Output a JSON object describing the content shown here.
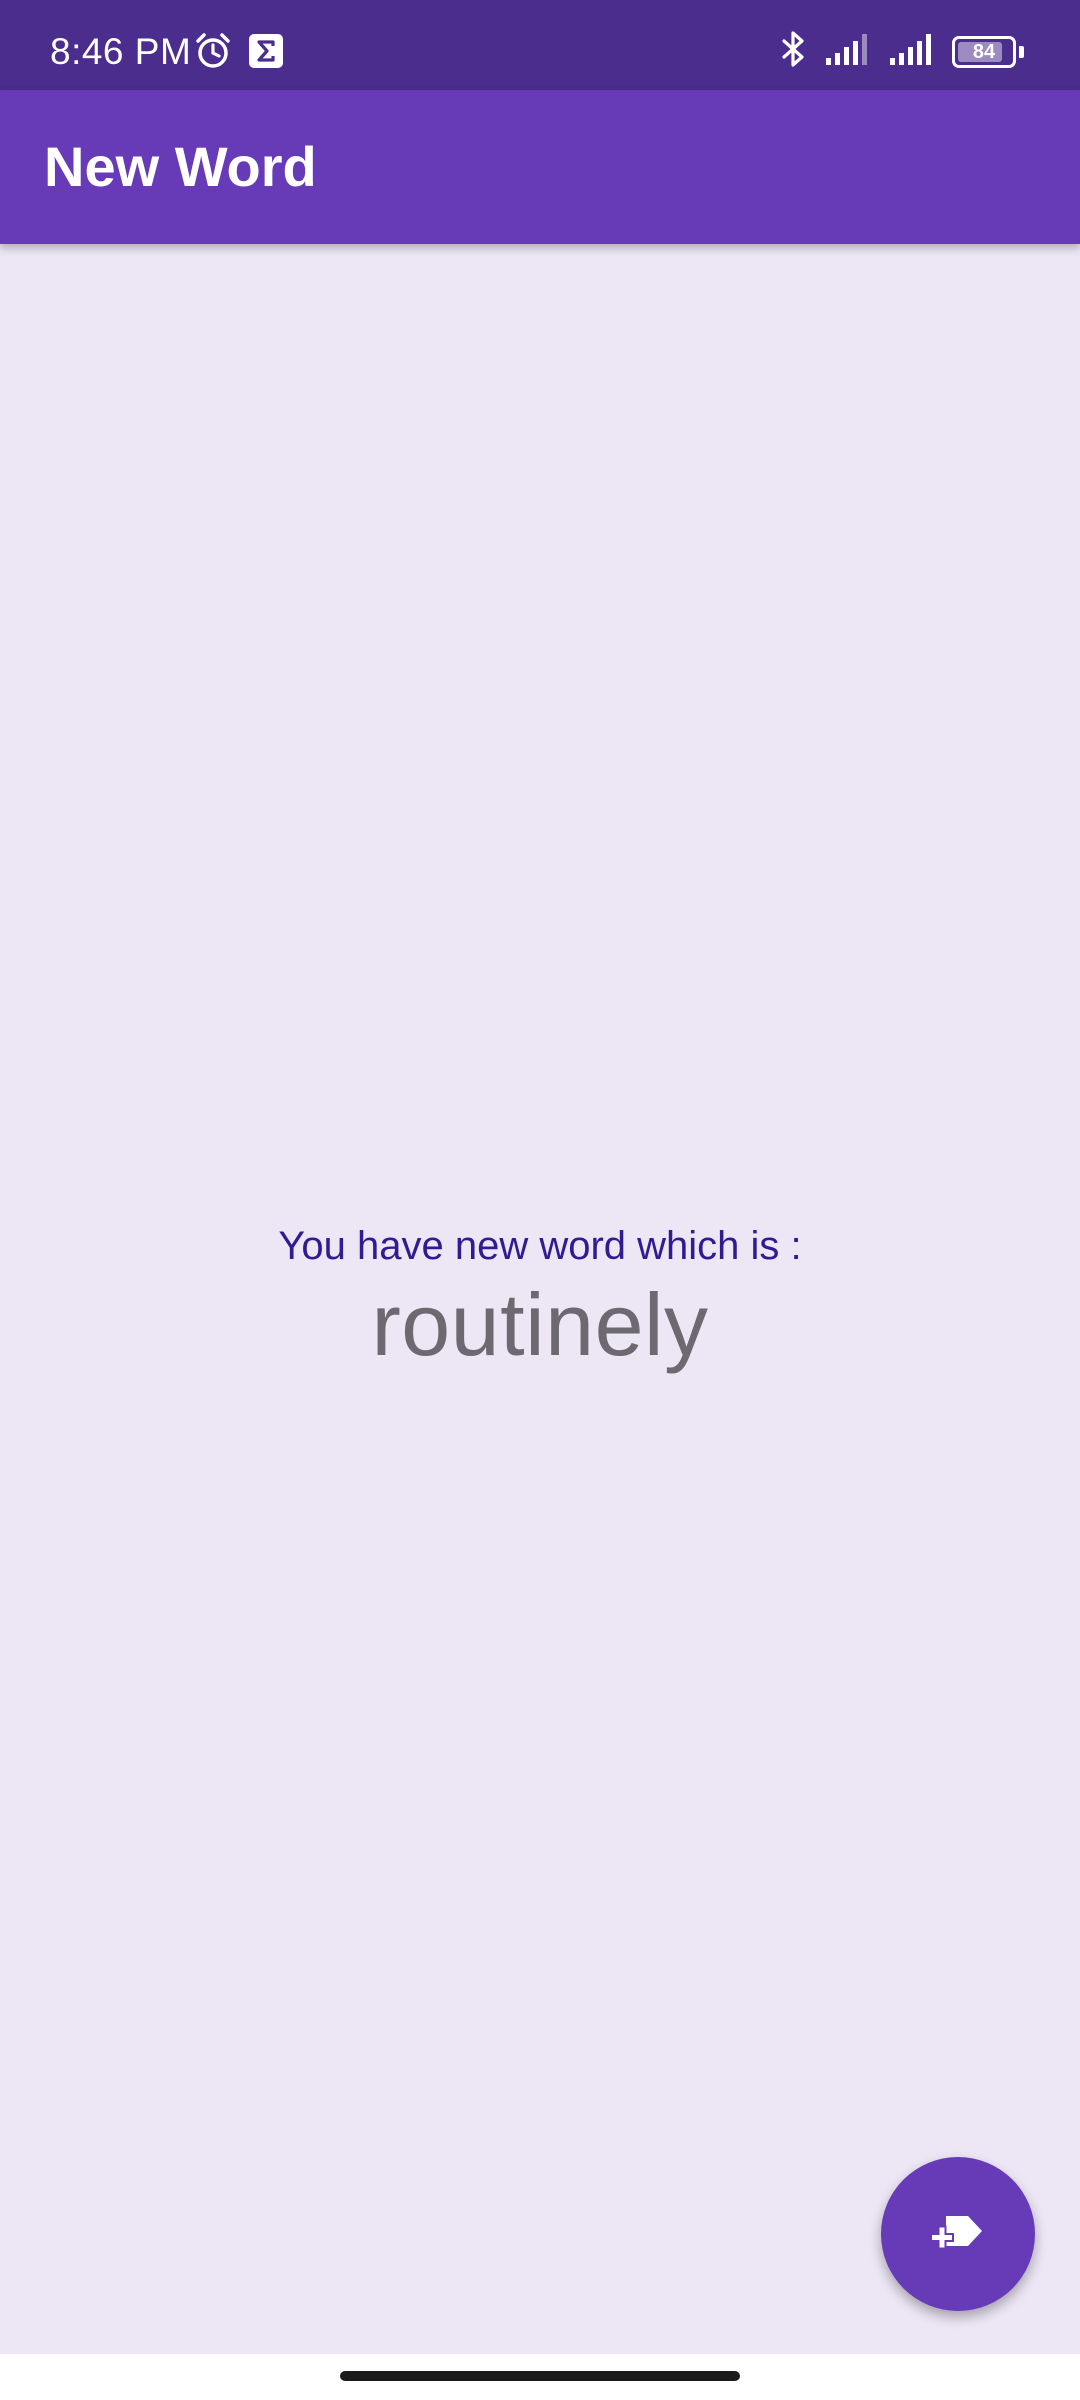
{
  "status_bar": {
    "time": "8:46 PM",
    "battery_percent": 84,
    "battery_label": "84",
    "icons_left": [
      "alarm-icon",
      "sigma-app-icon"
    ],
    "icons_right": [
      "bluetooth-icon",
      "signal-icon",
      "signal-icon",
      "battery-icon"
    ]
  },
  "app_bar": {
    "title": "New Word"
  },
  "main": {
    "message": "You have new word which is :",
    "word": "routinely"
  },
  "fab": {
    "icon": "add-label-icon"
  },
  "colors": {
    "status_bar": "#4a2d8c",
    "primary": "#673ab7",
    "background": "#ece6f5",
    "message_text": "#311b92",
    "word_text": "#6d6970"
  }
}
